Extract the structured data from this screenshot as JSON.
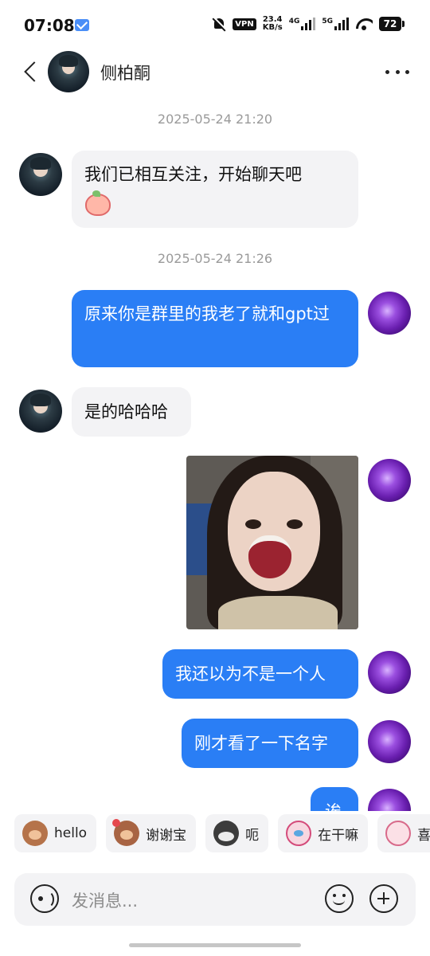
{
  "status_bar": {
    "time": "07:08",
    "vpn": "VPN",
    "speed_value": "23.4",
    "speed_unit": "KB/s",
    "net1": "4G",
    "net2": "5G",
    "battery": "72"
  },
  "header": {
    "contact_name": "侧柏酮"
  },
  "chat": {
    "timestamp_1": "2025-05-24 21:20",
    "timestamp_2": "2025-05-24 21:26",
    "messages": [
      {
        "side": "in",
        "text": "我们已相互关注，开始聊天吧"
      },
      {
        "side": "out",
        "text": "原来你是群里的我老了就和gpt过"
      },
      {
        "side": "in",
        "text": "是的哈哈哈"
      },
      {
        "side": "out",
        "type": "image"
      },
      {
        "side": "out",
        "text": "我还以为不是一个人"
      },
      {
        "side": "out",
        "text": "刚才看了一下名字"
      },
      {
        "side": "out",
        "text": "诶"
      }
    ]
  },
  "quick_replies": [
    {
      "label": "hello",
      "icon": "monkey-emoji"
    },
    {
      "label": "谢谢宝",
      "icon": "monkey-flower-emoji"
    },
    {
      "label": "呃",
      "icon": "cat-emoji"
    },
    {
      "label": "在干嘛",
      "icon": "bunny-emoji"
    },
    {
      "label": "喜",
      "icon": "bunny-emoji"
    }
  ],
  "input": {
    "placeholder": "发消息..."
  }
}
